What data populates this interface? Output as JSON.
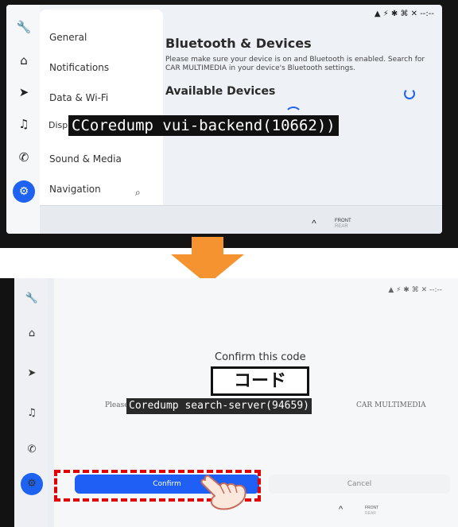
{
  "screen1": {
    "menu_items": [
      "General",
      "Notifications",
      "Data & Wi-Fi",
      "Disp",
      "Sound & Media",
      "Navigation"
    ],
    "status_bar": "▲  ⚡ ✱ ⌘ ✕   --:--",
    "section_title": "Bluetooth & Devices",
    "description": "Please make sure your device is on and Bluetooth is enabled. Search for CAR MULTIMEDIA in your device's Bluetooth settings.",
    "available_title": "Available Devices",
    "overlay_text": "CCoredump vui-backend(10662))",
    "footer_front": "FRONT",
    "footer_rear": "REAR",
    "chevron": "^"
  },
  "screen2": {
    "status_bar": "▲   ⚡ ✱ ⌘ ✕   --:--",
    "title": "Confirm this code",
    "code_label": "コード",
    "please_prefix": "Please che",
    "overlay_text": "Coredump search-server(94659)",
    "please_suffix": "CAR MULTIMEDIA",
    "confirm_label": "Confirm",
    "cancel_label": "Cancel",
    "footer_front": "FRONT",
    "footer_rear": "REAR",
    "chevron": "^"
  },
  "icons": {
    "rail": [
      "wrench-icon",
      "home-icon",
      "navigation-arrow-icon",
      "music-icon",
      "phone-icon",
      "settings-gear-icon"
    ]
  },
  "colors": {
    "accent_blue": "#1d62f0",
    "arrow_orange": "#f59331",
    "highlight_red": "#e00000"
  }
}
